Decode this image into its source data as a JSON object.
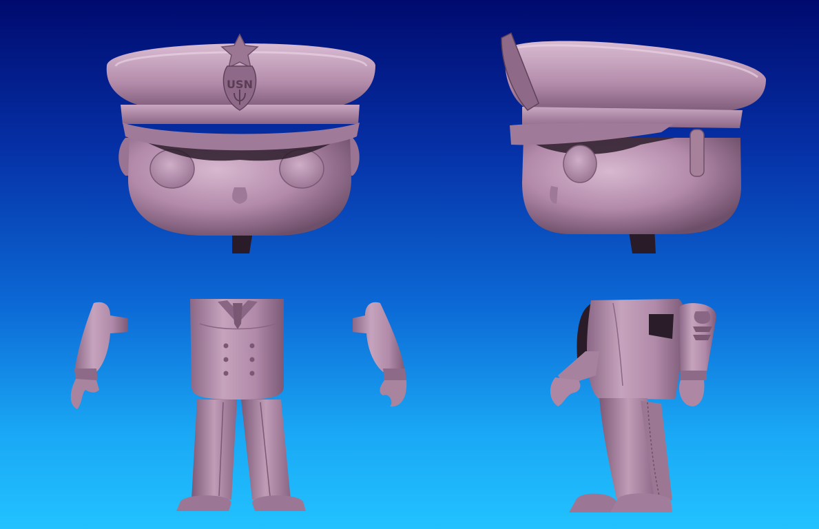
{
  "scene": {
    "background_top": "#000a6e",
    "background_bottom": "#22c2ff",
    "model_color": "#b98fb0",
    "model_shadow": "#6e4f6a",
    "model_highlight": "#e2c7dc",
    "badge_text": "USN"
  }
}
